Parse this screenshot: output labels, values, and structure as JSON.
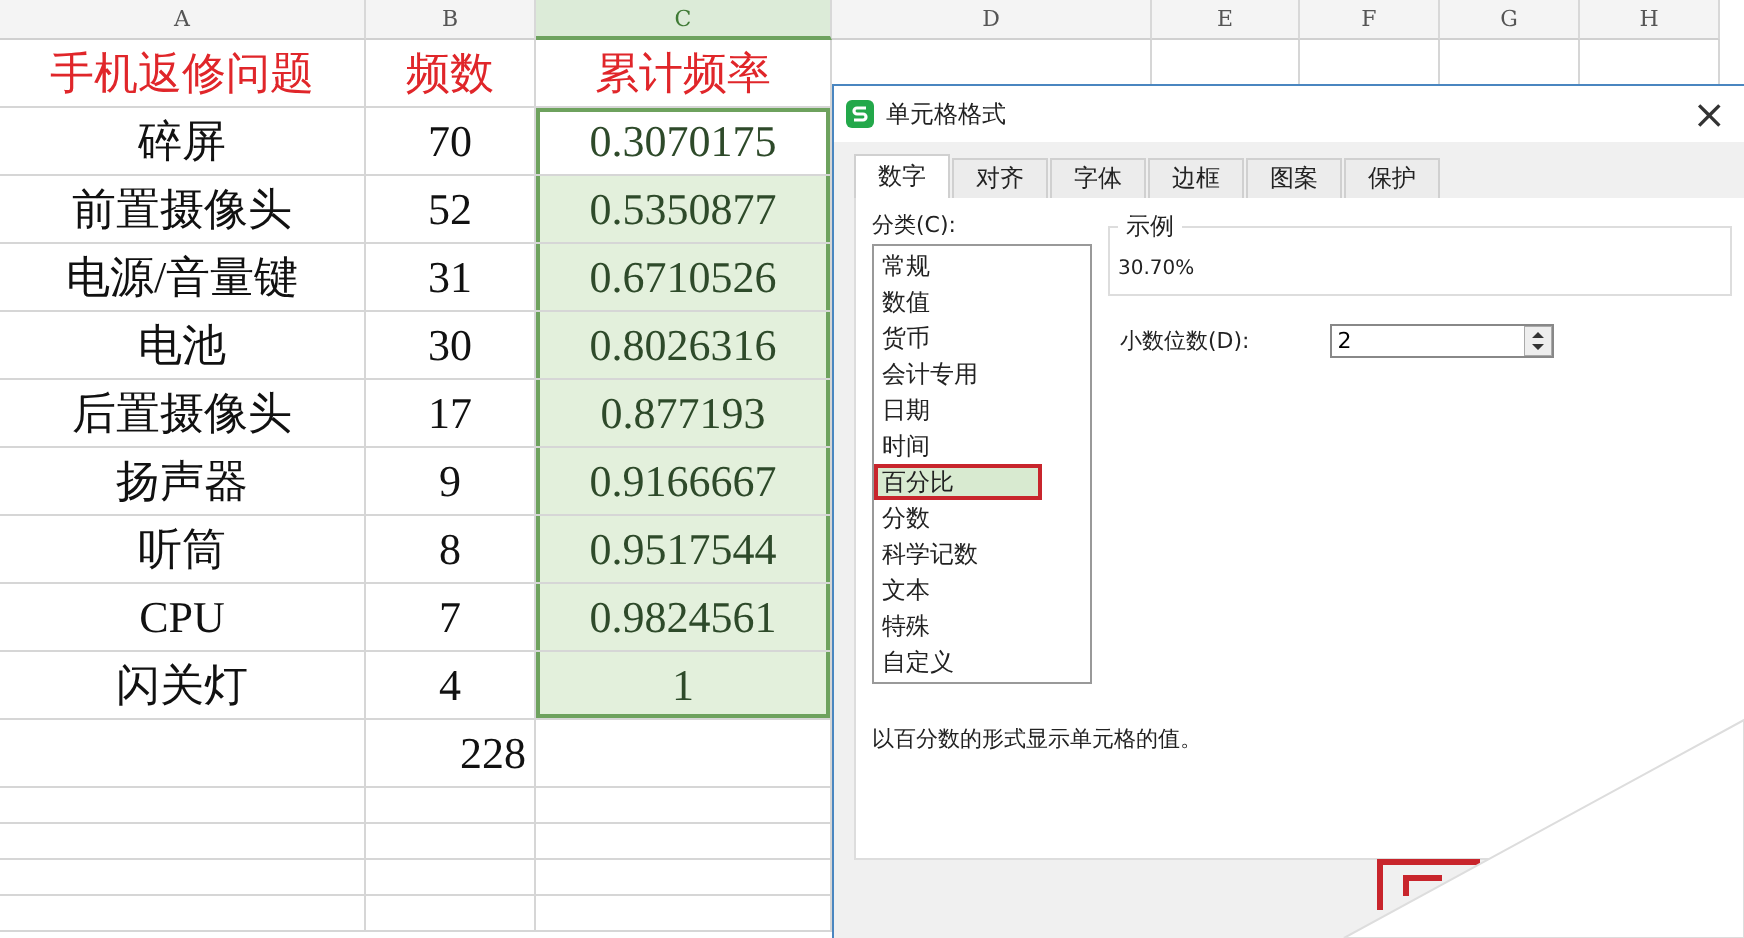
{
  "sheet": {
    "columns": [
      {
        "label": "A",
        "selected": false
      },
      {
        "label": "B",
        "selected": false
      },
      {
        "label": "C",
        "selected": true
      },
      {
        "label": "D",
        "selected": false
      },
      {
        "label": "E",
        "selected": false
      },
      {
        "label": "F",
        "selected": false
      },
      {
        "label": "G",
        "selected": false
      },
      {
        "label": "H",
        "selected": false
      }
    ],
    "header": [
      "手机返修问题",
      "频数",
      "累计频率"
    ],
    "rows": [
      {
        "cells": [
          "碎屏",
          "70",
          "0.3070175"
        ],
        "selected": true,
        "active": true
      },
      {
        "cells": [
          "前置摄像头",
          "52",
          "0.5350877"
        ],
        "selected": true,
        "active": false
      },
      {
        "cells": [
          "电源/音量键",
          "31",
          "0.6710526"
        ],
        "selected": true,
        "active": false
      },
      {
        "cells": [
          "电池",
          "30",
          "0.8026316"
        ],
        "selected": true,
        "active": false
      },
      {
        "cells": [
          "后置摄像头",
          "17",
          "0.877193"
        ],
        "selected": true,
        "active": false
      },
      {
        "cells": [
          "扬声器",
          "9",
          "0.9166667"
        ],
        "selected": true,
        "active": false
      },
      {
        "cells": [
          "听筒",
          "8",
          "0.9517544"
        ],
        "selected": true,
        "active": false
      },
      {
        "cells": [
          "CPU",
          "7",
          "0.9824561"
        ],
        "selected": true,
        "active": false
      },
      {
        "cells": [
          "闪关灯",
          "4",
          "1"
        ],
        "selected": true,
        "active": false
      }
    ],
    "total": "228"
  },
  "dialog": {
    "title": "单元格格式",
    "close": "×",
    "tabs": [
      {
        "label": "数字",
        "selected": true
      },
      {
        "label": "对齐",
        "selected": false
      },
      {
        "label": "字体",
        "selected": false
      },
      {
        "label": "边框",
        "selected": false
      },
      {
        "label": "图案",
        "selected": false
      },
      {
        "label": "保护",
        "selected": false
      }
    ],
    "category_label": "分类(C):",
    "categories": [
      {
        "label": "常规",
        "selected": false
      },
      {
        "label": "数值",
        "selected": false
      },
      {
        "label": "货币",
        "selected": false
      },
      {
        "label": "会计专用",
        "selected": false
      },
      {
        "label": "日期",
        "selected": false
      },
      {
        "label": "时间",
        "selected": false
      },
      {
        "label": "百分比",
        "selected": true
      },
      {
        "label": "分数",
        "selected": false
      },
      {
        "label": "科学记数",
        "selected": false
      },
      {
        "label": "文本",
        "selected": false
      },
      {
        "label": "特殊",
        "selected": false
      },
      {
        "label": "自定义",
        "selected": false
      }
    ],
    "sample_label": "示例",
    "sample_value": "30.70%",
    "decimal_label": "小数位数(D):",
    "decimal_value": "2",
    "description": "以百分数的形式显示单元格的值。"
  }
}
